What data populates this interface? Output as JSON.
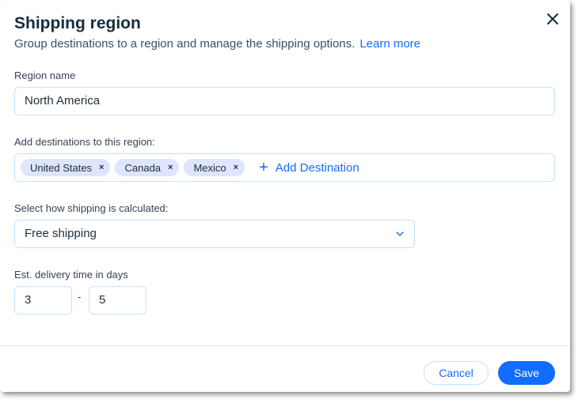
{
  "dialog": {
    "title": "Shipping region",
    "subtitle": "Group destinations to a region and manage the shipping options.",
    "learn_more": "Learn more",
    "close_icon": "close-icon"
  },
  "region": {
    "label": "Region name",
    "value": "North America"
  },
  "destinations": {
    "label": "Add destinations to this region:",
    "chips": [
      "United States",
      "Canada",
      "Mexico"
    ],
    "remove_symbol": "×",
    "add_symbol": "+",
    "add_label": "Add Destination"
  },
  "calculation": {
    "label": "Select how shipping is calculated:",
    "selected": "Free shipping"
  },
  "delivery": {
    "label": "Est. delivery time in days",
    "min": "3",
    "separator": "-",
    "max": "5"
  },
  "footer": {
    "cancel": "Cancel",
    "save": "Save"
  },
  "colors": {
    "accent": "#116dff",
    "chip_bg": "#dfe5ff",
    "border": "#c1e4fe"
  }
}
